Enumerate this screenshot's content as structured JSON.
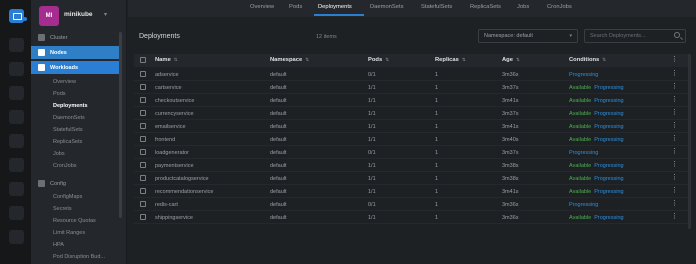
{
  "cluster": {
    "avatar_text": "MI",
    "name": "minikube",
    "accent_color": "#a52d8f"
  },
  "hotbar": {
    "active_color": "#2a7fd4"
  },
  "sidebar": {
    "items": [
      {
        "label": "Cluster",
        "icon": "cluster-icon"
      },
      {
        "label": "Nodes",
        "icon": "nodes-icon"
      },
      {
        "label": "Workloads",
        "icon": "workloads-icon"
      }
    ],
    "workload_subitems": [
      "Overview",
      "Pods",
      "Deployments",
      "DaemonSets",
      "StatefulSets",
      "ReplicaSets",
      "Jobs",
      "CronJobs"
    ],
    "config": {
      "label": "Config",
      "icon": "config-icon"
    },
    "config_subitems": [
      "ConfigMaps",
      "Secrets",
      "Resource Quotas",
      "Limit Ranges",
      "HPA",
      "Pod Disruption Bud..."
    ]
  },
  "tabs": [
    "Overview",
    "Pods",
    "Deployments",
    "DaemonSets",
    "StatefulSets",
    "ReplicaSets",
    "Jobs",
    "CronJobs"
  ],
  "active_tab": "Deployments",
  "main": {
    "title": "Deployments",
    "items_count": "12 items",
    "namespace_select": "Namespace: default",
    "search_placeholder": "Search Deployments..."
  },
  "table": {
    "columns": [
      "Name",
      "Namespace",
      "Pods",
      "Replicas",
      "Age",
      "Conditions"
    ],
    "rows": [
      {
        "name": "adservice",
        "namespace": "default",
        "pods": "0/1",
        "replicas": "1",
        "age": "3m36s",
        "conditions": [
          {
            "text": "Progressing",
            "status": "progressing"
          }
        ]
      },
      {
        "name": "cartservice",
        "namespace": "default",
        "pods": "1/1",
        "replicas": "1",
        "age": "3m37s",
        "conditions": [
          {
            "text": "Available",
            "status": "available"
          },
          {
            "text": "Progressing",
            "status": "progressing"
          }
        ]
      },
      {
        "name": "checkoutservice",
        "namespace": "default",
        "pods": "1/1",
        "replicas": "1",
        "age": "3m41s",
        "conditions": [
          {
            "text": "Available",
            "status": "available"
          },
          {
            "text": "Progressing",
            "status": "progressing"
          }
        ]
      },
      {
        "name": "currencyservice",
        "namespace": "default",
        "pods": "1/1",
        "replicas": "1",
        "age": "3m37s",
        "conditions": [
          {
            "text": "Available",
            "status": "available"
          },
          {
            "text": "Progressing",
            "status": "progressing"
          }
        ]
      },
      {
        "name": "emailservice",
        "namespace": "default",
        "pods": "1/1",
        "replicas": "1",
        "age": "3m41s",
        "conditions": [
          {
            "text": "Available",
            "status": "available"
          },
          {
            "text": "Progressing",
            "status": "progressing"
          }
        ]
      },
      {
        "name": "frontend",
        "namespace": "default",
        "pods": "1/1",
        "replicas": "1",
        "age": "3m40s",
        "conditions": [
          {
            "text": "Available",
            "status": "available"
          },
          {
            "text": "Progressing",
            "status": "progressing"
          }
        ]
      },
      {
        "name": "loadgenerator",
        "namespace": "default",
        "pods": "0/1",
        "replicas": "1",
        "age": "3m37s",
        "conditions": [
          {
            "text": "Progressing",
            "status": "progressing"
          }
        ]
      },
      {
        "name": "paymentservice",
        "namespace": "default",
        "pods": "1/1",
        "replicas": "1",
        "age": "3m38s",
        "conditions": [
          {
            "text": "Available",
            "status": "available"
          },
          {
            "text": "Progressing",
            "status": "progressing"
          }
        ]
      },
      {
        "name": "productcatalogservice",
        "namespace": "default",
        "pods": "1/1",
        "replicas": "1",
        "age": "3m38s",
        "conditions": [
          {
            "text": "Available",
            "status": "available"
          },
          {
            "text": "Progressing",
            "status": "progressing"
          }
        ]
      },
      {
        "name": "recommendationservice",
        "namespace": "default",
        "pods": "1/1",
        "replicas": "1",
        "age": "3m41s",
        "conditions": [
          {
            "text": "Available",
            "status": "available"
          },
          {
            "text": "Progressing",
            "status": "progressing"
          }
        ]
      },
      {
        "name": "redis-cart",
        "namespace": "default",
        "pods": "0/1",
        "replicas": "1",
        "age": "3m36s",
        "conditions": [
          {
            "text": "Progressing",
            "status": "progressing"
          }
        ]
      },
      {
        "name": "shippingservice",
        "namespace": "default",
        "pods": "1/1",
        "replicas": "1",
        "age": "3m36s",
        "conditions": [
          {
            "text": "Available",
            "status": "available"
          },
          {
            "text": "Progressing",
            "status": "progressing"
          }
        ]
      }
    ]
  },
  "colors": {
    "accent": "#2a7fd4",
    "available": "#4caf50",
    "progressing": "#2a8fe0"
  }
}
